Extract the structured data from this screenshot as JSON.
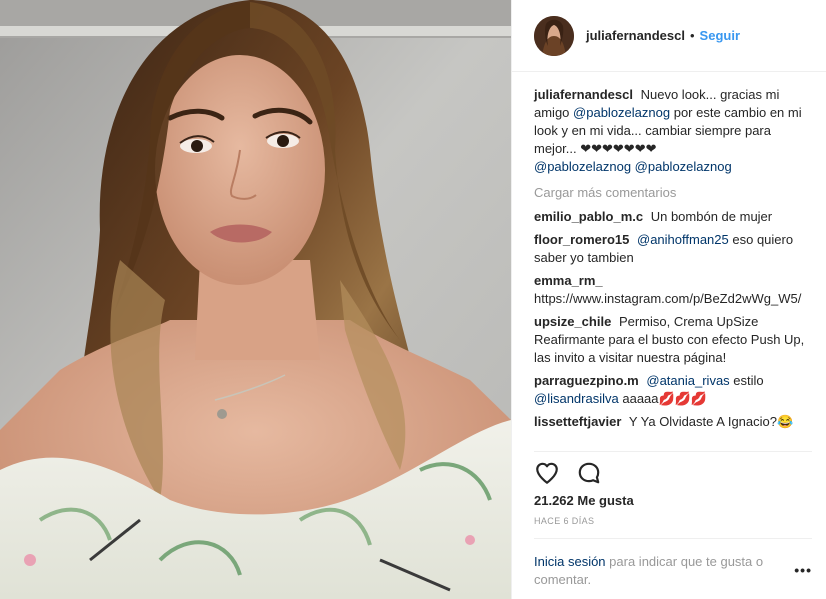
{
  "post": {
    "username": "juliafernandescl",
    "follow_label": "Seguir",
    "separator": "•",
    "caption": {
      "user": "juliafernandescl",
      "text1": "Nuevo look... gracias mi amigo",
      "mention1": "@pablozelaznog",
      "text2": "por este cambio en mi look y en mi vida... cambiar siempre para mejor... ❤❤❤❤❤❤❤",
      "mention2": "@pablozelaznog",
      "mention3": "@pablozelaznog"
    },
    "load_more": "Cargar más comentarios",
    "comments": [
      {
        "user": "emilio_pablo_m.c",
        "text": "Un bombón de mujer"
      },
      {
        "user": "floor_romero15",
        "mention": "@anihoffman25",
        "text": "eso quiero saber yo tambien"
      },
      {
        "user": "emma_rm_",
        "text": "https://www.instagram.com/p/BeZd2wWg_W5/"
      },
      {
        "user": "upsize_chile",
        "text": "Permiso, Crema UpSize Reafirmante para el busto con efecto Push Up, las invito a visitar nuestra página!"
      },
      {
        "user": "parraguezpino.m",
        "mention": "@atania_rivas",
        "text": "estilo",
        "mention2": "@lisandrasilva",
        "text2": "aaaaa💋💋💋"
      },
      {
        "user": "lissetteftjavier",
        "text": "Y Ya Olvidaste A Ignacio?😂"
      }
    ],
    "likes": "21.262 Me gusta",
    "time_ago": "HACE 6 DÍAS",
    "login_link": "Inicia sesión",
    "login_text": "para indicar que te gusta o comentar.",
    "more_dots": "•••"
  },
  "icons": {
    "like": "heart-outline-icon",
    "comment": "comment-bubble-icon",
    "options": "more-options-icon"
  },
  "colors": {
    "link_blue": "#3897f0",
    "mention_blue": "#003569",
    "muted": "#999999",
    "text": "#262626",
    "divider": "#efefef"
  }
}
